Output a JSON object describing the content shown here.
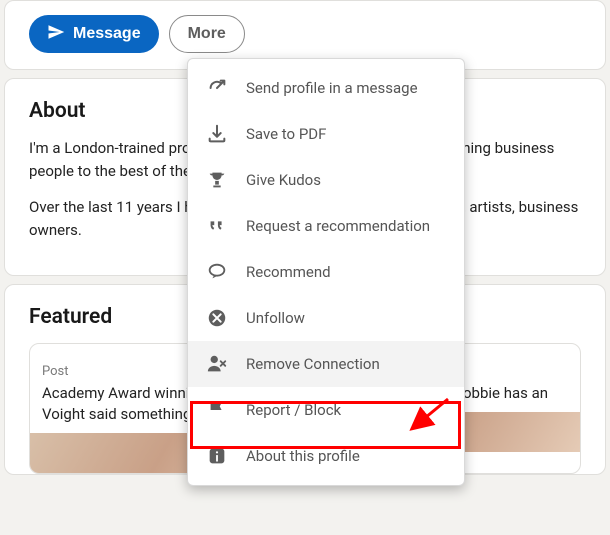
{
  "top": {
    "message_label": "Message",
    "more_label": "More"
  },
  "about": {
    "title": "About",
    "p1": "I'm a London-trained professional with extensive experience coaching business people to the best of their lives. It's different for everyone.",
    "p2": "Over the last 11 years I have worked with founders, entrepreneurs, artists, business owners."
  },
  "featured": {
    "title": "Featured",
    "post_label": "Post",
    "item1": "Academy Award winning actor Jon Voight said something",
    "item2": "Barbie star Margot Robbie has an"
  },
  "menu": {
    "items": [
      {
        "id": "send-profile",
        "label": "Send profile in a message",
        "icon": "share-arrow"
      },
      {
        "id": "save-pdf",
        "label": "Save to PDF",
        "icon": "download"
      },
      {
        "id": "give-kudos",
        "label": "Give Kudos",
        "icon": "trophy"
      },
      {
        "id": "request-rec",
        "label": "Request a recommendation",
        "icon": "quotes"
      },
      {
        "id": "recommend",
        "label": "Recommend",
        "icon": "speech"
      },
      {
        "id": "unfollow",
        "label": "Unfollow",
        "icon": "x-circle"
      },
      {
        "id": "remove-conn",
        "label": "Remove Connection",
        "icon": "person-x",
        "hovered": true
      },
      {
        "id": "report-block",
        "label": "Report / Block",
        "icon": "flag"
      },
      {
        "id": "about-profile",
        "label": "About this profile",
        "icon": "info"
      }
    ]
  }
}
